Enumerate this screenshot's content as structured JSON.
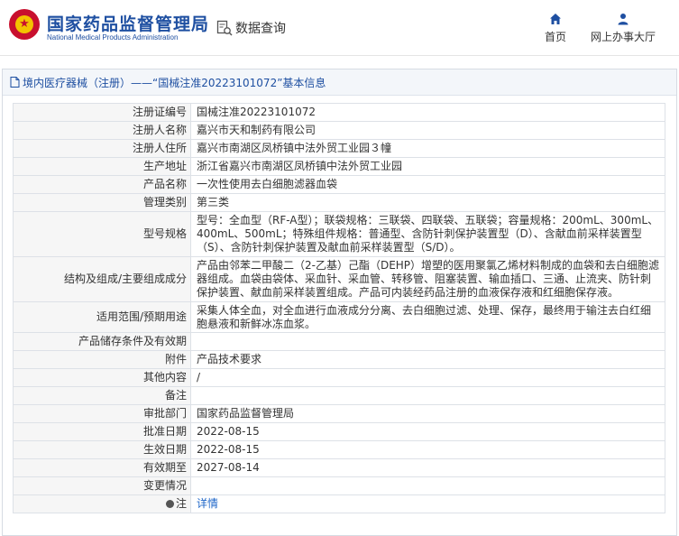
{
  "header": {
    "title": "国家药品监督管理局",
    "subtitle": "National Medical Products Administration",
    "search_label": "数据查询",
    "nav": [
      {
        "label": "首页",
        "icon": "home-icon"
      },
      {
        "label": "网上办事大厅",
        "icon": "user-icon"
      }
    ]
  },
  "panel": {
    "title": "境内医疗器械（注册）——“国械注准20223101072”基本信息"
  },
  "fields": [
    {
      "label": "注册证编号",
      "value": "国械注准20223101072"
    },
    {
      "label": "注册人名称",
      "value": "嘉兴市天和制药有限公司"
    },
    {
      "label": "注册人住所",
      "value": "嘉兴市南湖区凤桥镇中法外贸工业园３幢"
    },
    {
      "label": "生产地址",
      "value": "浙江省嘉兴市南湖区凤桥镇中法外贸工业园"
    },
    {
      "label": "产品名称",
      "value": "一次性使用去白细胞滤器血袋"
    },
    {
      "label": "管理类别",
      "value": "第三类"
    },
    {
      "label": "型号规格",
      "value": "型号：全血型（RF-A型）；联袋规格：三联袋、四联袋、五联袋；容量规格：200mL、300mL、400mL、500mL；特殊组件规格：普通型、含防针刺保护装置型（D）、含献血前采样装置型（S）、含防针刺保护装置及献血前采样装置型（S/D）。"
    },
    {
      "label": "结构及组成/主要组成成分",
      "value": "产品由邻苯二甲酸二（2-乙基）己酯（DEHP）增塑的医用聚氯乙烯材料制成的血袋和去白细胞滤器组成。血袋由袋体、采血针、采血管、转移管、阻塞装置、输血插口、三通、止流夹、防针刺保护装置、献血前采样装置组成。产品可内装经药品注册的血液保存液和红细胞保存液。"
    },
    {
      "label": "适用范围/预期用途",
      "value": "采集人体全血，对全血进行血液成分分离、去白细胞过滤、处理、保存，最终用于输注去白红细胞悬液和新鲜冰冻血浆。"
    },
    {
      "label": "产品储存条件及有效期",
      "value": ""
    },
    {
      "label": "附件",
      "value": "产品技术要求"
    },
    {
      "label": "其他内容",
      "value": "/"
    },
    {
      "label": "备注",
      "value": ""
    },
    {
      "label": "审批部门",
      "value": "国家药品监督管理局"
    },
    {
      "label": "批准日期",
      "value": "2022-08-15"
    },
    {
      "label": "生效日期",
      "value": "2022-08-15"
    },
    {
      "label": "有效期至",
      "value": "2027-08-14"
    },
    {
      "label": "变更情况",
      "value": ""
    },
    {
      "label": "注",
      "value": "详情"
    }
  ],
  "colors": {
    "brand_blue": "#1e4fa1",
    "link_blue": "#1e66c8",
    "logo_red": "#c8102e",
    "logo_gold": "#f3c300"
  }
}
